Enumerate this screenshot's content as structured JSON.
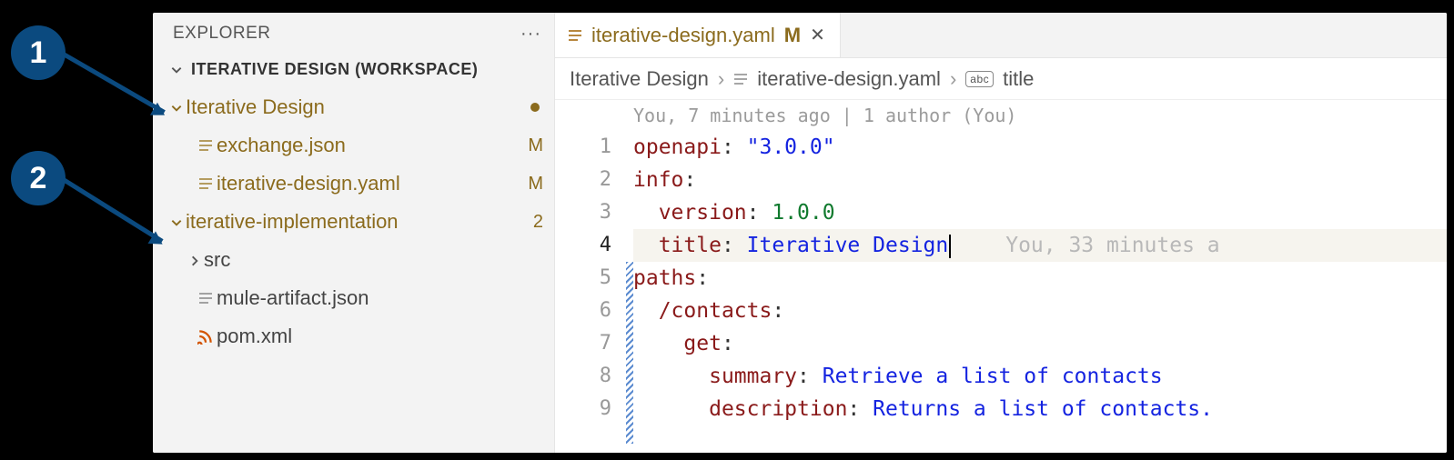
{
  "callouts": {
    "one": "1",
    "two": "2"
  },
  "sidebar": {
    "title": "EXPLORER",
    "workspace": "ITERATIVE DESIGN (WORKSPACE)",
    "nodes": {
      "proj1": {
        "label": "Iterative Design"
      },
      "f1": {
        "label": "exchange.json",
        "marker": "M"
      },
      "f2": {
        "label": "iterative-design.yaml",
        "marker": "M"
      },
      "proj2": {
        "label": "iterative-implementation",
        "marker": "2"
      },
      "src": {
        "label": "src"
      },
      "f3": {
        "label": "mule-artifact.json"
      },
      "f4": {
        "label": "pom.xml"
      }
    }
  },
  "tab": {
    "filename": "iterative-design.yaml",
    "marker": "M"
  },
  "breadcrumbs": {
    "seg1": "Iterative Design",
    "seg2": "iterative-design.yaml",
    "seg3": "title"
  },
  "blame": {
    "top": "You, 7 minutes ago | 1 author (You)",
    "line4": "You, 33 minutes a"
  },
  "gutter": [
    "1",
    "2",
    "3",
    "4",
    "5",
    "6",
    "7",
    "8",
    "9"
  ],
  "code": {
    "l1k": "openapi",
    "l1v": "\"3.0.0\"",
    "l2k": "info",
    "l3k": "version",
    "l3v": "1.0.0",
    "l4k": "title",
    "l4v": "Iterative Design",
    "l5k": "paths",
    "l6k": "/contacts",
    "l7k": "get",
    "l8k": "summary",
    "l8v": "Retrieve a list of contacts",
    "l9k": "description",
    "l9v": "Returns a list of contacts."
  }
}
